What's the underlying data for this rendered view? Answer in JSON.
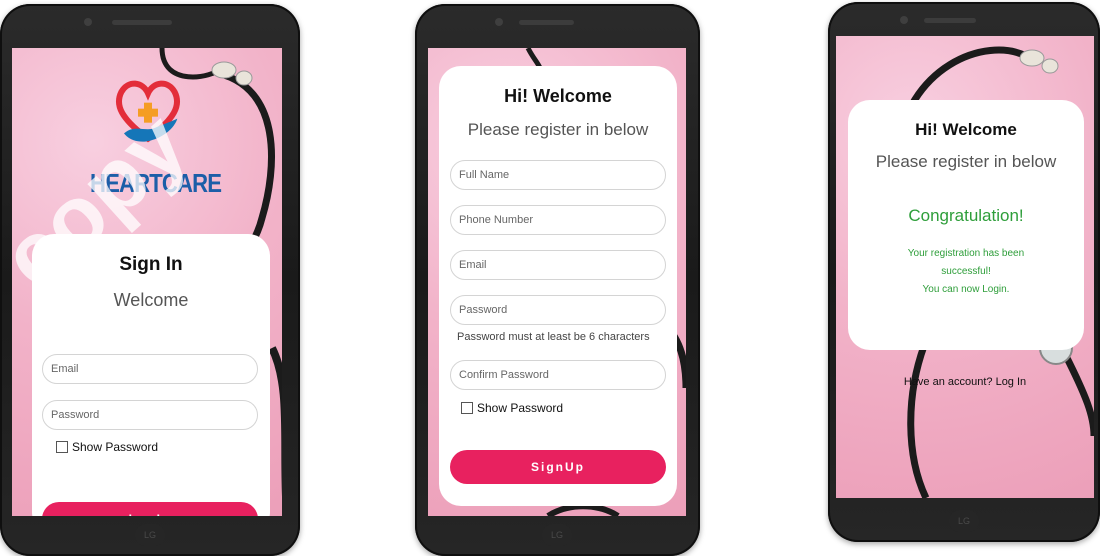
{
  "screens": {
    "signin": {
      "brand": "HEARTCARE",
      "title": "Sign In",
      "subtitle": "Welcome",
      "email_placeholder": "Email",
      "password_placeholder": "Password",
      "show_password": "Show Password",
      "login_button": "LogIn"
    },
    "register": {
      "title": "Hi! Welcome",
      "subtitle": "Please register in below",
      "fullname_placeholder": "Full Name",
      "phone_placeholder": "Phone Number",
      "email_placeholder": "Email",
      "password_placeholder": "Password",
      "password_hint": "Password must at least be 6 characters",
      "confirm_placeholder": "Confirm Password",
      "show_password": "Show Password",
      "signup_button": "SignUp"
    },
    "success": {
      "title": "Hi! Welcome",
      "subtitle": "Please register in below",
      "congrats": "Congratulation!",
      "message_line1": "Your registration has been",
      "message_line2": "successful!",
      "message_line3": "You can now Login.",
      "login_link": "Have an account? Log In"
    }
  },
  "device_brand": "LG",
  "watermark": "copy",
  "colors": {
    "accent": "#e8215f",
    "success": "#2e9e3a",
    "background": "#f4bcd0"
  }
}
